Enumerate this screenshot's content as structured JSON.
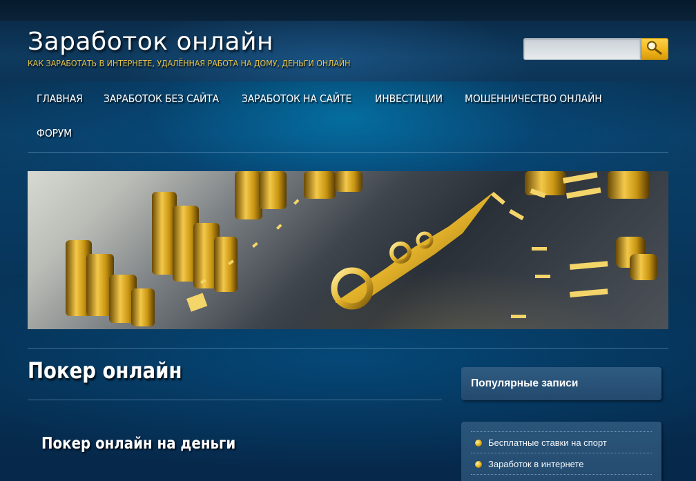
{
  "site": {
    "title": "Заработок онлайн",
    "tagline": "КАК ЗАРАБОТАТЬ В ИНТЕРНЕТЕ, УДАЛЁННАЯ РАБОТА НА ДОМУ, ДЕНЬГИ ОНЛАЙН"
  },
  "search": {
    "placeholder": "",
    "value": "",
    "button_icon": "magnifier-icon"
  },
  "nav": {
    "items": [
      {
        "label": "ГЛАВНАЯ"
      },
      {
        "label": "ЗАРАБОТОК БЕЗ САЙТА"
      },
      {
        "label": "ЗАРАБОТОК НА САЙТЕ"
      },
      {
        "label": "ИНВЕСТИЦИИ"
      },
      {
        "label": "МОШЕННИЧЕСТВО ОНЛАЙН"
      },
      {
        "label": "ФОРУМ"
      }
    ]
  },
  "banner": {
    "image": "gold-coins-clock-banner"
  },
  "main": {
    "page_title": "Покер онлайн",
    "post_title": "Покер онлайн на деньги"
  },
  "sidebar": {
    "widget_title": "Популярные записи",
    "popular": [
      {
        "label": "Бесплатные ставки на спорт"
      },
      {
        "label": "Заработок в интернете"
      }
    ]
  },
  "colors": {
    "background": "#0a3558",
    "accent_gold": "#e8c34a",
    "search_button": "#f2b51c",
    "widget": "#2a5479"
  }
}
